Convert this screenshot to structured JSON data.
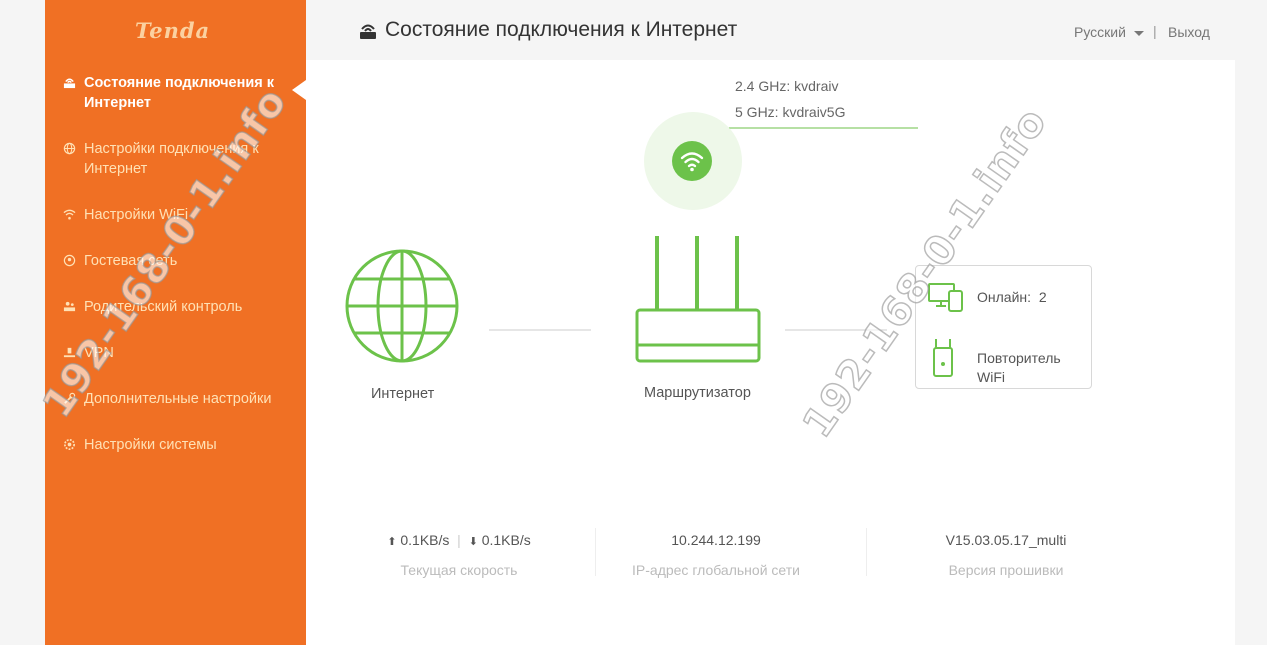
{
  "brand": {
    "logo_text": "Tenda",
    "accent": "#f07024",
    "green": "#6cc24a"
  },
  "sidebar": {
    "items": [
      {
        "label": "Состояние подключения к Интернет",
        "icon": "router-status-icon",
        "active": true
      },
      {
        "label": "Настройки подключения к Интернет",
        "icon": "globe-icon"
      },
      {
        "label": "Настройки WiFi",
        "icon": "wifi-icon"
      },
      {
        "label": "Гостевая сеть",
        "icon": "guest-network-icon"
      },
      {
        "label": "Родительский контроль",
        "icon": "parental-control-icon"
      },
      {
        "label": "VPN",
        "icon": "vpn-icon"
      },
      {
        "label": "Дополнительные настройки",
        "icon": "advanced-settings-icon"
      },
      {
        "label": "Настройки системы",
        "icon": "system-settings-icon"
      }
    ]
  },
  "header": {
    "title": "Состояние подключения к Интернет",
    "language": "Русский",
    "separator": "|",
    "logout": "Выход"
  },
  "wifi": {
    "ssid_24": "2.4 GHz: kvdraiv",
    "ssid_5": "5 GHz: kvdraiv5G"
  },
  "diagram": {
    "internet_label": "Интернет",
    "router_label": "Маршрутизатор",
    "online_label": "Онлайн:",
    "online_count": "2",
    "repeater_label": "Повторитель WiFi"
  },
  "stats": {
    "upload": "0.1KB/s",
    "speed_separator": "|",
    "download": "0.1KB/s",
    "speed_caption": "Текущая скорость",
    "ip": "10.244.12.199",
    "ip_caption": "IP-адрес глобальной сети",
    "firmware": "V15.03.05.17_multi",
    "firmware_caption": "Версия прошивки"
  },
  "watermark": {
    "text": "192-168-0-1.info"
  }
}
